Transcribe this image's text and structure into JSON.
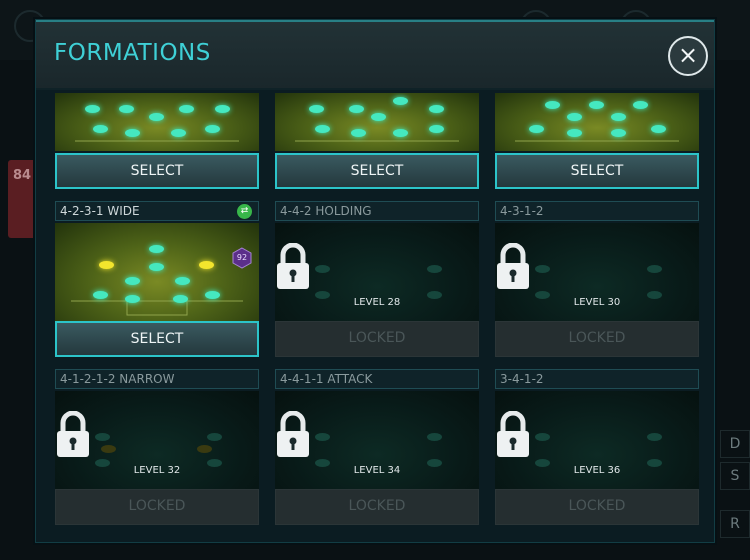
{
  "modal": {
    "title": "FORMATIONS",
    "close_icon": "×"
  },
  "background": {
    "card_rating": "84",
    "side_labels": [
      "D",
      "S",
      "R"
    ]
  },
  "badges": {
    "rating": "92",
    "switch_icon": "⇄"
  },
  "formations": [
    {
      "name": "",
      "select": "SELECT"
    },
    {
      "name": "",
      "select": "SELECT"
    },
    {
      "name": "",
      "select": "SELECT"
    },
    {
      "name": "4-2-3-1 WIDE",
      "select": "SELECT"
    },
    {
      "name": "4-4-2 HOLDING",
      "level": "LEVEL 28",
      "status": "LOCKED"
    },
    {
      "name": "4-3-1-2",
      "level": "LEVEL 30",
      "status": "LOCKED"
    },
    {
      "name": "4-1-2-1-2 NARROW",
      "level": "LEVEL 32",
      "status": "LOCKED"
    },
    {
      "name": "4-4-1-1 ATTACK",
      "level": "LEVEL 34",
      "status": "LOCKED"
    },
    {
      "name": "3-4-1-2",
      "level": "LEVEL 36",
      "status": "LOCKED"
    }
  ],
  "colors": {
    "accent": "#3fd0d6",
    "pitch_active": "#5a6e1c",
    "player_dot": "#45e8c0",
    "captain_dot": "#f3e52d",
    "locked_text": "#4a5658"
  }
}
